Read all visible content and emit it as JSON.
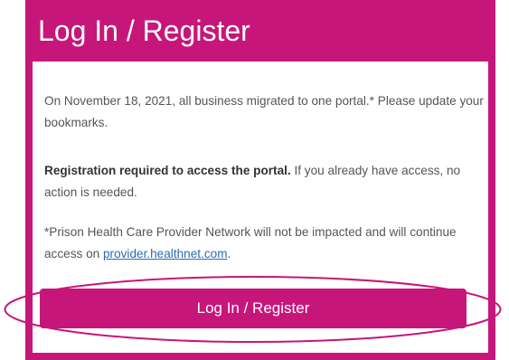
{
  "header": {
    "title": "Log In / Register"
  },
  "notice": {
    "p1": "On November 18, 2021, all business migrated to one portal.* Please update your bookmarks.",
    "p2_bold": "Registration required to access the portal.",
    "p2_rest": " If you already have access, no action is needed.",
    "p3_before": "*Prison Health Care Provider Network will not be impacted and will continue access on ",
    "p3_link": "provider.healthnet.com",
    "p3_after": "."
  },
  "button": {
    "label": "Log In / Register"
  },
  "colors": {
    "brand": "#c7167a",
    "link": "#2a6bb3"
  }
}
